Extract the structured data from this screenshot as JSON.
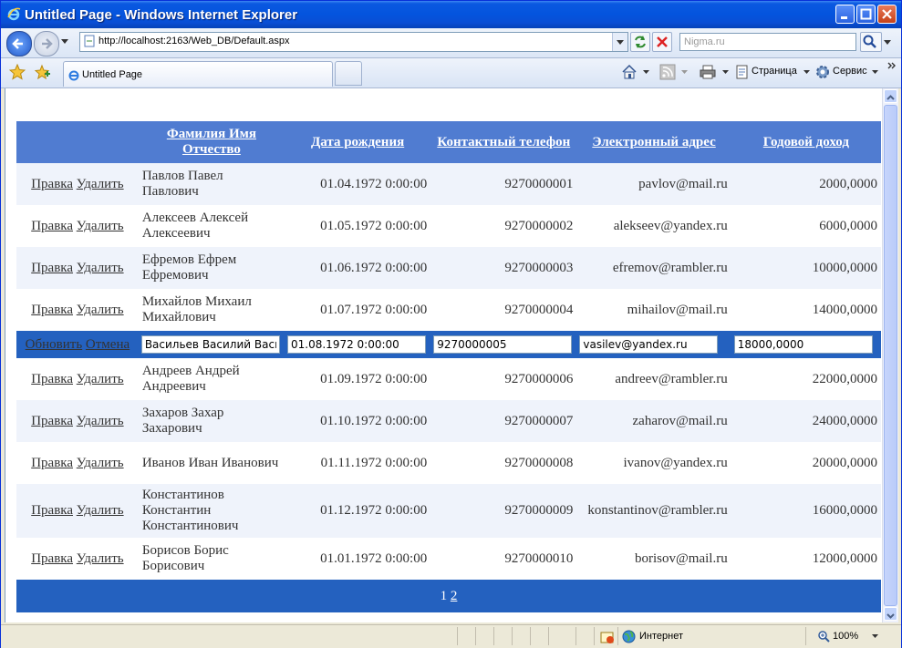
{
  "window": {
    "title": "Untitled Page - Windows Internet Explorer"
  },
  "address": {
    "url": "http://localhost:2163/Web_DB/Default.aspx",
    "search_placeholder": "Nigma.ru"
  },
  "tabs": [
    {
      "label": "Untitled Page"
    }
  ],
  "command_bar": {
    "page_label": "Страница",
    "service_label": "Сервис"
  },
  "status": {
    "zone": "Интернет",
    "zoom": "100%"
  },
  "grid": {
    "headers": [
      "Фамилия Имя Отчество",
      "Дата рождения",
      "Контактный телефон",
      "Электронный адрес",
      "Годовой доход"
    ],
    "edit_link": "Правка",
    "delete_link": "Удалить",
    "update_link": "Обновить",
    "cancel_link": "Отмена",
    "rows": [
      {
        "name": "Павлов Павел Павлович",
        "birth": "01.04.1972 0:00:00",
        "phone": "9270000001",
        "email": "pavlov@mail.ru",
        "income": "2000,0000"
      },
      {
        "name": "Алексеев Алексей Алексеевич",
        "birth": "01.05.1972 0:00:00",
        "phone": "9270000002",
        "email": "alekseev@yandex.ru",
        "income": "6000,0000"
      },
      {
        "name": "Ефремов Ефрем Ефремович",
        "birth": "01.06.1972 0:00:00",
        "phone": "9270000003",
        "email": "efremov@rambler.ru",
        "income": "10000,0000"
      },
      {
        "name": "Михайлов Михаил Михайлович",
        "birth": "01.07.1972 0:00:00",
        "phone": "9270000004",
        "email": "mihailov@mail.ru",
        "income": "14000,0000"
      },
      {
        "name": "Васильев Василий Васильевич",
        "birth": "01.08.1972 0:00:00",
        "phone": "9270000005",
        "email": "vasilev@yandex.ru",
        "income": "18000,0000"
      },
      {
        "name": "Андреев Андрей Андреевич",
        "birth": "01.09.1972 0:00:00",
        "phone": "9270000006",
        "email": "andreev@rambler.ru",
        "income": "22000,0000"
      },
      {
        "name": "Захаров Захар Захарович",
        "birth": "01.10.1972 0:00:00",
        "phone": "9270000007",
        "email": "zaharov@mail.ru",
        "income": "24000,0000"
      },
      {
        "name": "Иванов Иван Иванович",
        "birth": "01.11.1972 0:00:00",
        "phone": "9270000008",
        "email": "ivanov@yandex.ru",
        "income": "20000,0000"
      },
      {
        "name": "Константинов Константин Константинович",
        "birth": "01.12.1972 0:00:00",
        "phone": "9270000009",
        "email": "konstantinov@rambler.ru",
        "income": "16000,0000"
      },
      {
        "name": "Борисов Борис Борисович",
        "birth": "01.01.1972 0:00:00",
        "phone": "9270000010",
        "email": "borisov@mail.ru",
        "income": "12000,0000"
      }
    ],
    "pager": {
      "current": "1",
      "next": "2"
    }
  },
  "colors": {
    "header": "#507cd1",
    "edit_row": "#2461bf",
    "alt_row": "#eff3fb"
  }
}
